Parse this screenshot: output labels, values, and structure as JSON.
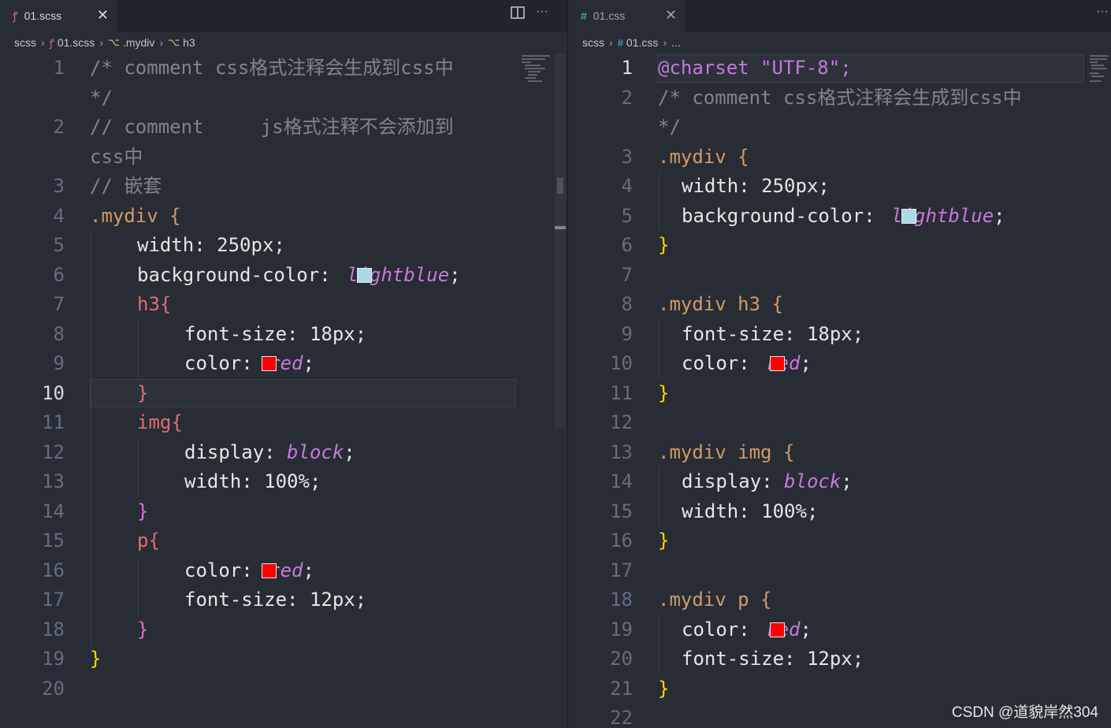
{
  "left": {
    "tab": {
      "label": "01.scss",
      "icon": "sass-icon",
      "close": "✕"
    },
    "breadcrumb": [
      {
        "label": "scss",
        "icon": ""
      },
      {
        "label": "01.scss",
        "icon": "sass-icon"
      },
      {
        "label": ".mydiv",
        "icon": "selector-icon"
      },
      {
        "label": "h3",
        "icon": "selector-icon"
      }
    ],
    "actions": {
      "split": "▯",
      "more": "···"
    },
    "line_numbers": [
      "1",
      "",
      "2",
      "",
      "3",
      "4",
      "5",
      "6",
      "7",
      "8",
      "9",
      "10",
      "11",
      "12",
      "13",
      "14",
      "15",
      "16",
      "17",
      "18",
      "19",
      "20"
    ],
    "active_line": "10",
    "lines": [
      "/* comment css格式注释会生成到css中",
      "*/",
      "// comment     js格式注释不会添加到",
      "css中",
      "// 嵌套",
      ".mydiv {",
      "width: 250px;",
      "background-color: lightblue;",
      "h3{",
      "font-size: 18px;",
      "color: red;",
      "}",
      "img{",
      "display: block;",
      "width: 100%;",
      "}",
      "p{",
      "color: red;",
      "font-size: 12px;",
      "}",
      "}",
      ""
    ]
  },
  "right": {
    "tab": {
      "label": "01.css",
      "icon": "css-hash-icon",
      "close": "✕"
    },
    "breadcrumb": [
      {
        "label": "scss",
        "icon": ""
      },
      {
        "label": "01.css",
        "icon": "css-hash-icon"
      },
      {
        "label": "...",
        "icon": ""
      }
    ],
    "actions": {
      "more": "···"
    },
    "line_numbers": [
      "1",
      "2",
      "",
      "3",
      "4",
      "5",
      "6",
      "7",
      "8",
      "9",
      "10",
      "11",
      "12",
      "13",
      "14",
      "15",
      "16",
      "17",
      "18",
      "19",
      "20",
      "21",
      "22"
    ],
    "active_line": "1",
    "lines": [
      "@charset \"UTF-8\";",
      "/* comment css格式注释会生成到css中",
      "*/",
      ".mydiv {",
      "width: 250px;",
      "background-color: lightblue;",
      "}",
      "",
      ".mydiv h3 {",
      "font-size: 18px;",
      "color: red;",
      "}",
      "",
      ".mydiv img {",
      "display: block;",
      "width: 100%;",
      "}",
      "",
      ".mydiv p {",
      "color: red;",
      "font-size: 12px;",
      "}",
      ""
    ]
  },
  "colors": {
    "lightblue": "#add8e6",
    "red": "#ff0000",
    "background": "#282c34"
  },
  "watermark": "CSDN @道貌岸然304"
}
